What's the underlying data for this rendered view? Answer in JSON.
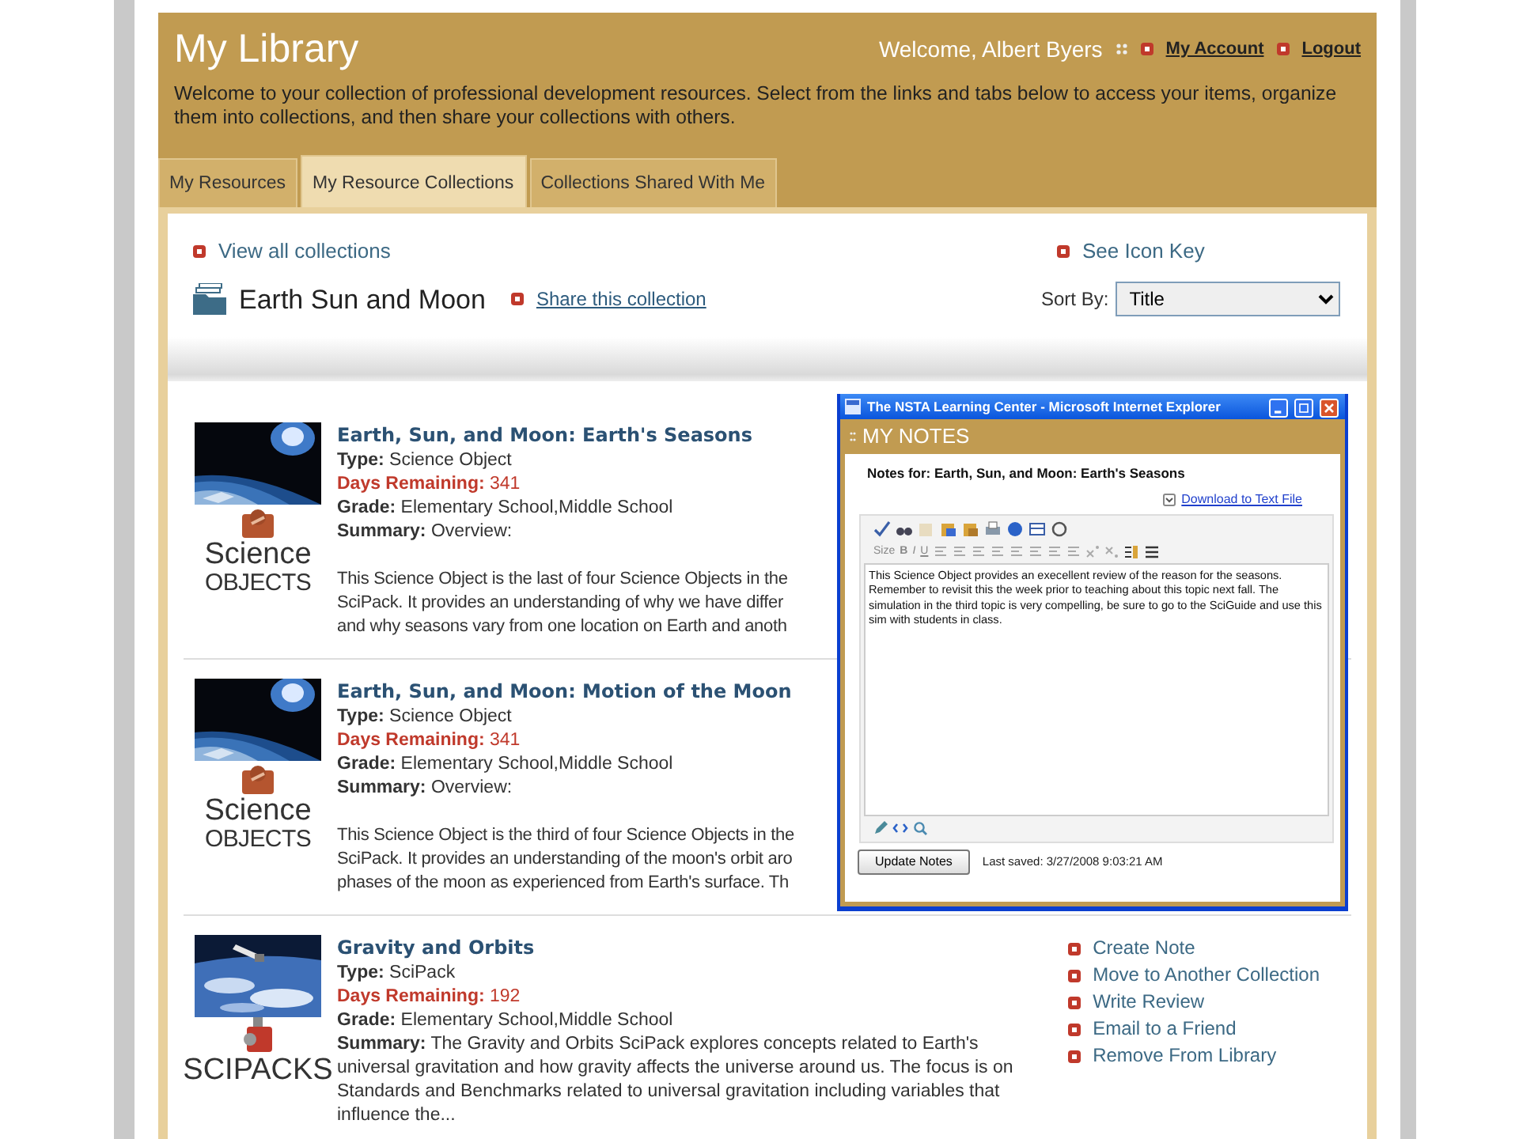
{
  "header": {
    "title": "My Library",
    "welcome": "Welcome, Albert Byers",
    "links": [
      "My Account",
      "Logout"
    ],
    "intro": "Welcome to your collection of professional development resources. Select from the links and tabs below to access your items, organize them into collections, and then share your collections with others."
  },
  "tabs": [
    {
      "label": "My Resources",
      "selected": false
    },
    {
      "label": "My Resource Collections",
      "selected": true
    },
    {
      "label": "Collections Shared With Me",
      "selected": false
    }
  ],
  "collection": {
    "view_all": "View all collections",
    "icon_key": "See Icon Key",
    "name": "Earth Sun and Moon",
    "share": "Share this collection",
    "sort_label": "Sort By:",
    "sort_value": "Title"
  },
  "items": [
    {
      "kind": "science-object",
      "logo": [
        "Science",
        "OBJECTS"
      ],
      "title": "Earth, Sun, and Moon: Earth's Seasons",
      "type": "**Type:** Science Object",
      "days": "**Days Remaining:** 341",
      "grade": "**Grade:** Elementary School,Middle School",
      "summary_head": "**Summary:** Overview:",
      "summary_lines": [
        "This Science Object is the last of four Science Objects in the",
        "SciPack. It provides an understanding of why we have differ",
        "and why seasons vary from one location on Earth and anoth"
      ]
    },
    {
      "kind": "science-object",
      "logo": [
        "Science",
        "OBJECTS"
      ],
      "title": "Earth, Sun, and Moon: Motion of the Moon",
      "type": "**Type:** Science Object",
      "days": "**Days Remaining:** 341",
      "grade": "**Grade:** Elementary School,Middle School",
      "summary_head": "**Summary:** Overview:",
      "summary_lines": [
        "This Science Object is the third of four Science Objects in the",
        "SciPack. It provides an understanding of the moon's orbit aro",
        "phases of the moon as experienced from Earth's surface. Th"
      ]
    },
    {
      "kind": "scipack",
      "logo": [
        "SCIPACKS"
      ],
      "title": "Gravity and Orbits",
      "type": "**Type:** SciPack",
      "days": "**Days Remaining:** 192",
      "grade": "**Grade:** Elementary School,Middle School",
      "summary_head": "**Summary:** The Gravity and Orbits SciPack explores concepts related to Earth's universal gravitation and how gravity affects the universe around us. The focus is on Standards and Benchmarks related to universal gravitation including variables that influence the...",
      "actions": [
        "Create Note",
        "Move to Another Collection",
        "Write Review",
        "Email to a Friend",
        "Remove From Library"
      ]
    }
  ],
  "notes_window": {
    "title": "The NSTA Learning Center - Microsoft Internet Explorer",
    "heading": "MY NOTES",
    "notes_for": "Notes for: Earth, Sun, and Moon: Earth's Seasons",
    "download": "Download to Text File",
    "format_buttons": [
      "Size",
      "B",
      "I",
      "U"
    ],
    "note": "This Science Object provides an execellent review of the reason for the seasons. Remember to revisit this the week prior to teaching about this topic next fall. The simulation in the third topic is very compelling, be sure to go to the SciGuide and use this sim with students in class.",
    "update_button": "Update Notes",
    "last_saved": "Last saved: 3/27/2008 9:03:21 AM"
  }
}
